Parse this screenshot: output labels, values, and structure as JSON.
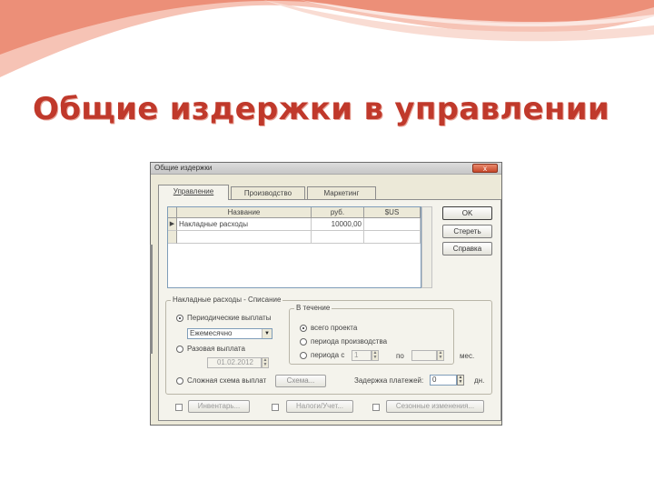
{
  "slide": {
    "title": "Общие издержки в управлении"
  },
  "colors": {
    "title": "#c0392b",
    "accent_wave": "#e8836e"
  },
  "dialog": {
    "title": "Общие издержки",
    "close_label": "x",
    "tabs": [
      {
        "label": "Управление",
        "active": true
      },
      {
        "label": "Производство",
        "active": false
      },
      {
        "label": "Маркетинг",
        "active": false
      }
    ],
    "table": {
      "columns": [
        "Название",
        "руб.",
        "$US"
      ],
      "rows": [
        {
          "marker": "▶",
          "name": "Накладные расходы",
          "rub": "10000,00",
          "usd": ""
        }
      ]
    },
    "buttons": {
      "ok": "OK",
      "delete": "Стереть",
      "help": "Справка"
    },
    "overhead": {
      "group_label": "Накладные расходы - Списание",
      "periodic_label": "Периодические выплаты",
      "periodic_selected": true,
      "frequency": "Ежемесячно",
      "onetime_label": "Разовая выплата",
      "onetime_date": "01.02.2012",
      "complex_label": "Сложная схема выплат",
      "scheme_button": "Схема...",
      "during": {
        "group_label": "В течение",
        "options": [
          "всего проекта",
          "периода производства",
          "периода с"
        ],
        "selected": 0,
        "from_value": "1",
        "to_label": "по",
        "to_value": "",
        "unit": "мес."
      },
      "delay_label": "Задержка платежей:",
      "delay_value": "0",
      "delay_unit": "дн."
    },
    "footer": {
      "inventory_label": "Инвентарь...",
      "taxes_label": "Налоги/Учет...",
      "seasonal_label": "Сезонные изменения..."
    }
  }
}
